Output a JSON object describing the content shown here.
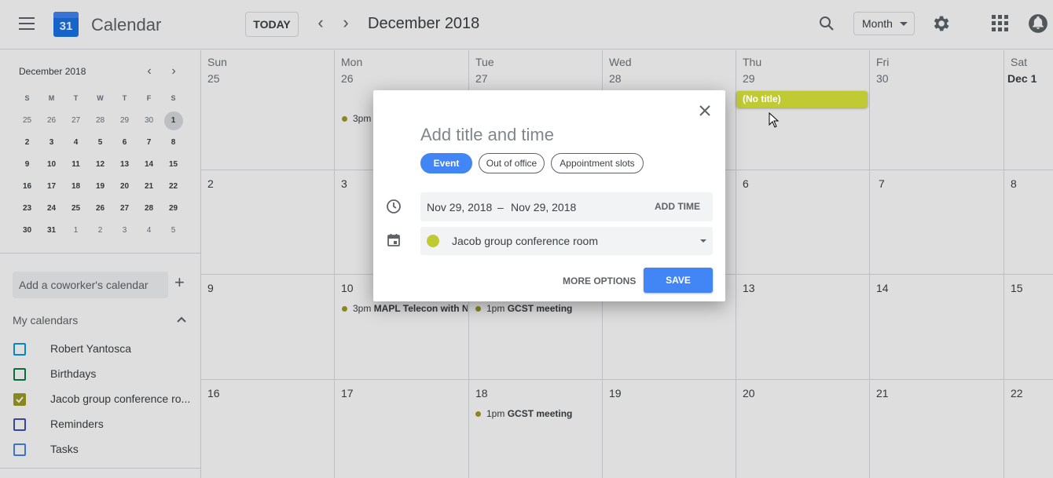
{
  "header": {
    "app_title": "Calendar",
    "logo_day": "31",
    "today_label": "TODAY",
    "prev_icon": "chevron-left-icon",
    "next_icon": "chevron-right-icon",
    "month_title": "December 2018",
    "view_select": "Month",
    "icons": [
      "menu-icon",
      "search-icon",
      "gear-icon",
      "apps-icon",
      "notifications-icon"
    ]
  },
  "sidebar": {
    "mini_calendar": {
      "title": "December 2018",
      "days_of_week": [
        "S",
        "M",
        "T",
        "W",
        "T",
        "F",
        "S"
      ],
      "weeks": [
        [
          "25",
          "26",
          "27",
          "28",
          "29",
          "30",
          "1"
        ],
        [
          "2",
          "3",
          "4",
          "5",
          "6",
          "7",
          "8"
        ],
        [
          "9",
          "10",
          "11",
          "12",
          "13",
          "14",
          "15"
        ],
        [
          "16",
          "17",
          "18",
          "19",
          "20",
          "21",
          "22"
        ],
        [
          "23",
          "24",
          "25",
          "26",
          "27",
          "28",
          "29"
        ],
        [
          "30",
          "31",
          "1",
          "2",
          "3",
          "4",
          "5"
        ]
      ],
      "selected": "1"
    },
    "coworker_placeholder": "Add a coworker's calendar",
    "my_calendars_label": "My calendars",
    "calendars": [
      {
        "label": "Robert Yantosca",
        "color": "#039be5",
        "checked": false
      },
      {
        "label": "Birthdays",
        "color": "#0b8043",
        "checked": false
      },
      {
        "label": "Jacob group conference ro...",
        "color": "#9e9d24",
        "checked": true
      },
      {
        "label": "Reminders",
        "color": "#3f51b5",
        "checked": false
      },
      {
        "label": "Tasks",
        "color": "#4285f4",
        "checked": false
      }
    ]
  },
  "month_grid": {
    "days_of_week": [
      "Sun",
      "Mon",
      "Tue",
      "Wed",
      "Thu",
      "Fri",
      "Sat"
    ],
    "weeks": [
      [
        "25",
        "26",
        "27",
        "28",
        "29",
        "30",
        "Dec 1"
      ],
      [
        "2",
        "3",
        "4",
        "5",
        "6",
        "7",
        "8"
      ],
      [
        "9",
        "10",
        "11",
        "12",
        "13",
        "14",
        "15"
      ],
      [
        "16",
        "17",
        "18",
        "19",
        "20",
        "21",
        "22"
      ]
    ],
    "events": [
      {
        "time": "3pm",
        "title": ""
      },
      {
        "time": "3pm",
        "title": "MAPL Telecon with N"
      },
      {
        "time": "1pm",
        "title": "GCST meeting"
      },
      {
        "time": "1pm",
        "title": "GCST meeting"
      }
    ],
    "no_title_chip": "(No title)"
  },
  "dialog": {
    "title_placeholder": "Add title and time",
    "chips": [
      "Event",
      "Out of office",
      "Appointment slots"
    ],
    "start_date": "Nov 29, 2018",
    "dash": "–",
    "end_date": "Nov 29, 2018",
    "add_time_label": "ADD TIME",
    "room": "Jacob group conference room",
    "room_color": "#c0ca33",
    "more_options_label": "MORE OPTIONS",
    "save_label": "SAVE"
  }
}
